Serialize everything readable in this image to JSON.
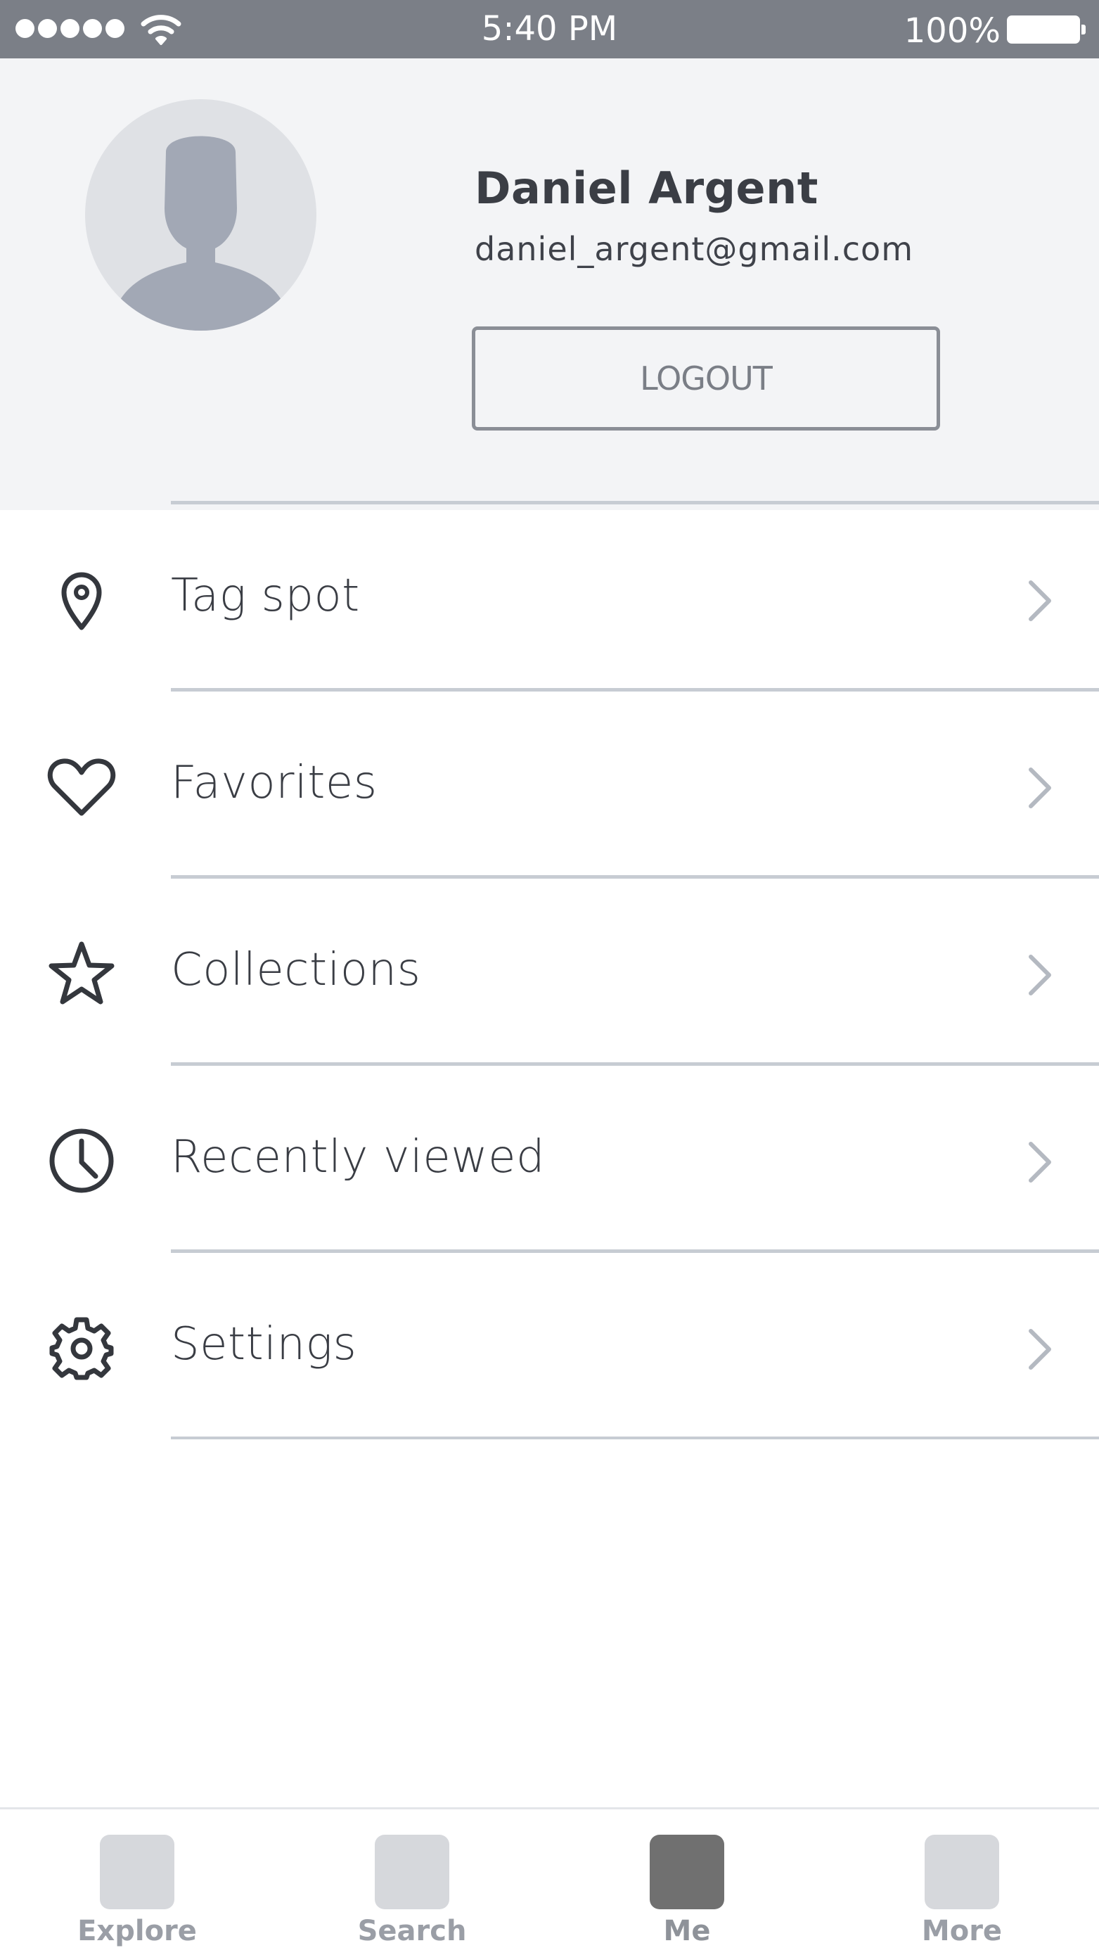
{
  "status_bar": {
    "signal_dots": 5,
    "time": "5:40 PM",
    "battery_percent": "100%",
    "icons": [
      "signal-icon",
      "wifi-icon",
      "battery-icon"
    ]
  },
  "profile": {
    "name": "Daniel Argent",
    "email": "daniel_argent@gmail.com",
    "logout_label": "LOGOUT",
    "avatar_icon": "user-silhouette-icon"
  },
  "menu": {
    "items": [
      {
        "label": "Tag spot",
        "icon": "map-pin-icon"
      },
      {
        "label": "Favorites",
        "icon": "heart-icon"
      },
      {
        "label": "Collections",
        "icon": "star-icon"
      },
      {
        "label": "Recently viewed",
        "icon": "clock-icon"
      },
      {
        "label": "Settings",
        "icon": "gear-icon"
      }
    ],
    "chevron_icon": "chevron-right-icon"
  },
  "tab_bar": {
    "tabs": [
      {
        "label": "Explore",
        "active": false
      },
      {
        "label": "Search",
        "active": false
      },
      {
        "label": "Me",
        "active": true
      },
      {
        "label": "More",
        "active": false
      }
    ]
  },
  "colors": {
    "status_bar": "#7b7f87",
    "profile_bg": "#f3f4f6",
    "divider": "#c7ccd3",
    "text": "#3a3d44",
    "chevron": "#b4b9c1",
    "tab_inactive": "#d6d8dc",
    "tab_active": "#707070"
  }
}
